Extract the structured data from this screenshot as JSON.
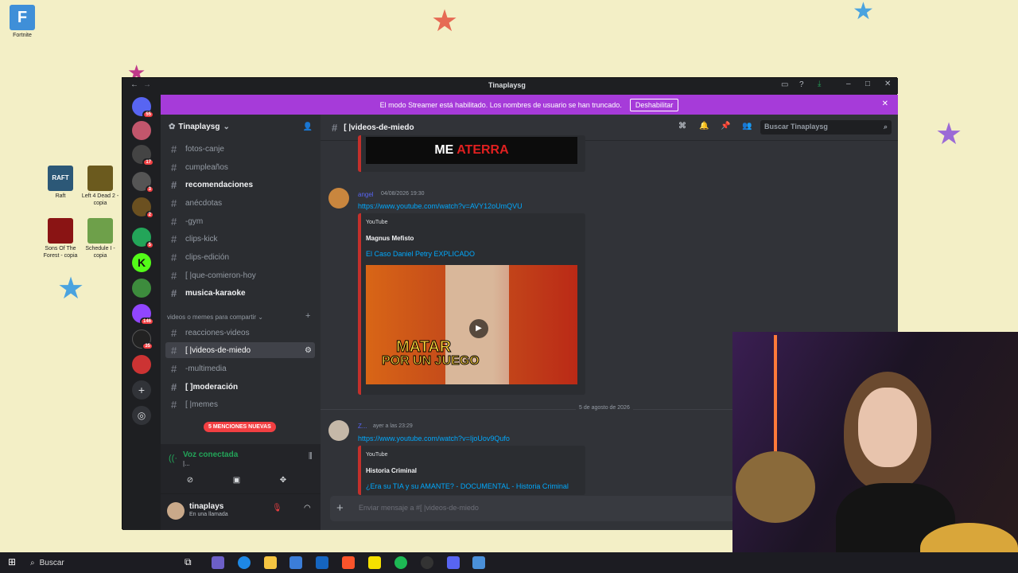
{
  "desktop": {
    "icons": [
      {
        "label": "Fortnite"
      },
      {
        "label": "Raft"
      },
      {
        "label": "Left 4 Dead 2 - copia"
      },
      {
        "label": "Sons Of The Forest - copia"
      },
      {
        "label": "Schedule I - copia"
      }
    ]
  },
  "window": {
    "title": "Tinaplaysg",
    "banner_text": "El modo Streamer está habilitado. Los nombres de usuario se han truncado.",
    "banner_button": "Deshabilitar"
  },
  "servers": {
    "badges": [
      "55",
      "17",
      "3",
      "2",
      "5",
      "146",
      "35"
    ]
  },
  "sidebar": {
    "server_name": "Tinaplaysg",
    "channels": [
      {
        "label": "fotos-canje"
      },
      {
        "label": "cumpleaños"
      },
      {
        "label": "recomendaciones"
      },
      {
        "label": "anécdotas"
      },
      {
        "label": "-gym"
      },
      {
        "label": "clips-kick"
      },
      {
        "label": "clips-edición"
      },
      {
        "label": "[ |que-comieron-hoy"
      },
      {
        "label": "musica-karaoke"
      }
    ],
    "category": "videos o memes para compartir",
    "channels2": [
      {
        "label": "reacciones-videos"
      },
      {
        "label": "[ |videos-de-miedo"
      },
      {
        "label": "-multimedia"
      },
      {
        "label": "[ ]moderación"
      },
      {
        "label": "[ |memes"
      }
    ],
    "mentions_pill": "5 MENCIONES NUEVAS",
    "voice_status": "Voz conectada",
    "voice_sub": "|...",
    "username": "tinaplays",
    "user_status": "En una llamada"
  },
  "main": {
    "channel_name": "[ |videos-de-miedo",
    "search_placeholder": "Buscar Tinaplaysg",
    "top_embed_text1": "ME",
    "top_embed_text2": "ATERRA",
    "messages": [
      {
        "author": "angel",
        "time": "04/08/2026 19:30",
        "link": "https://www.youtube.com/watch?v=AVY12oUmQVU",
        "provider": "YouTube",
        "embed_author": "Magnus Mefisto",
        "embed_title": "El Caso Daniel Petry EXPLICADO",
        "thumb_text1": "MATAR",
        "thumb_text2": "POR UN JUEGO"
      },
      {
        "author": "Z...",
        "time": "ayer a las 23:29",
        "link": "https://www.youtube.com/watch?v=IjoUov9Qufo",
        "provider": "YouTube",
        "embed_author": "Historia Criminal",
        "embed_title": "¿Era su TIA y su AMANTE? - DOCUMENTAL - Historia Criminal"
      }
    ],
    "date_divider": "5 de agosto de 2026",
    "input_placeholder": "Enviar mensaje a #[ |videos-de-miedo"
  },
  "taskbar": {
    "search_label": "Buscar"
  },
  "colors": {
    "banner": "#a63bd9",
    "link": "#00a8fc",
    "mention": "#f23f42"
  }
}
